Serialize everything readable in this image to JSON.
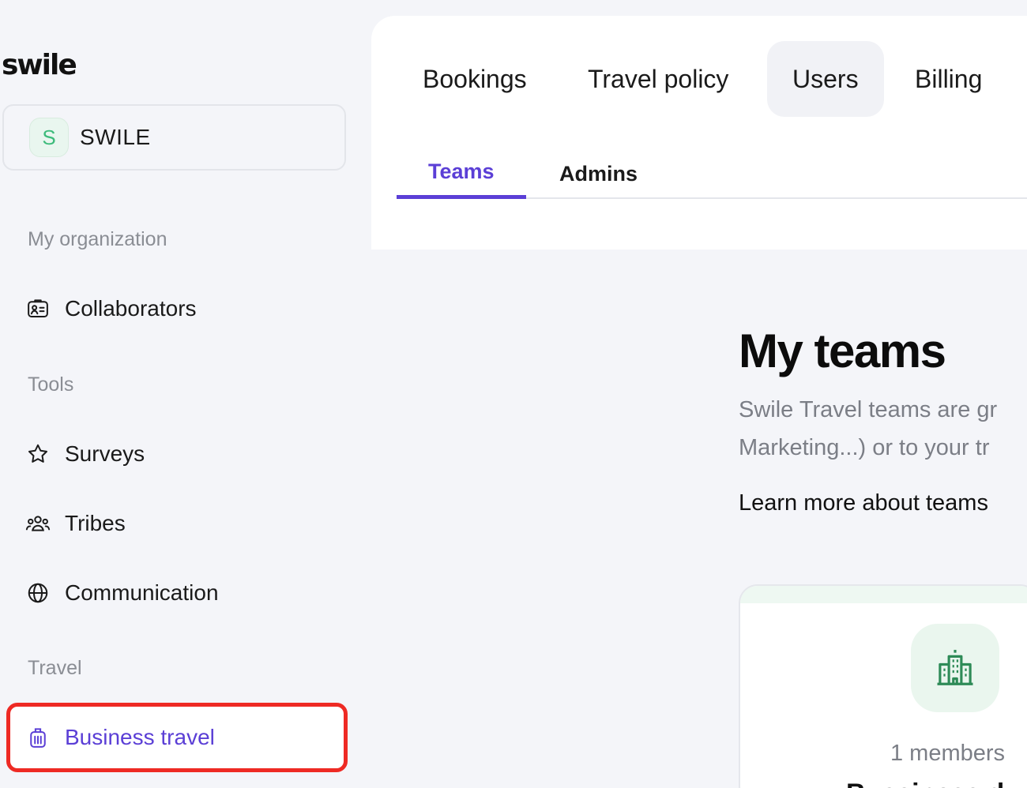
{
  "app": {
    "logo": "swile"
  },
  "org_switcher": {
    "avatar_letter": "S",
    "name": "SWILE"
  },
  "sidebar": {
    "sections": [
      {
        "label": "My organization"
      },
      {
        "label": "Tools"
      },
      {
        "label": "Travel"
      }
    ],
    "items": [
      {
        "label": "Collaborators",
        "icon": "badge-icon"
      },
      {
        "label": "Surveys",
        "icon": "star-icon"
      },
      {
        "label": "Tribes",
        "icon": "people-icon"
      },
      {
        "label": "Communication",
        "icon": "globe-icon"
      },
      {
        "label": "Business travel",
        "icon": "luggage-icon",
        "active": true
      }
    ]
  },
  "top_tabs": [
    {
      "label": "Bookings"
    },
    {
      "label": "Travel policy"
    },
    {
      "label": "Users",
      "selected": true
    },
    {
      "label": "Billing"
    }
  ],
  "sub_tabs": [
    {
      "label": "Teams",
      "selected": true
    },
    {
      "label": "Admins"
    }
  ],
  "main": {
    "title": "My teams",
    "description_line1": "Swile Travel teams are gr",
    "description_line2": "Marketing...) or to your tr",
    "learn_more": "Learn more about teams"
  },
  "team_card": {
    "members": "1 members",
    "name": "Bussiness d"
  },
  "colors": {
    "accent": "#5b3fd6",
    "highlight_frame": "#ee2a24",
    "green": "#2e8b57",
    "background": "#f4f5f9"
  }
}
